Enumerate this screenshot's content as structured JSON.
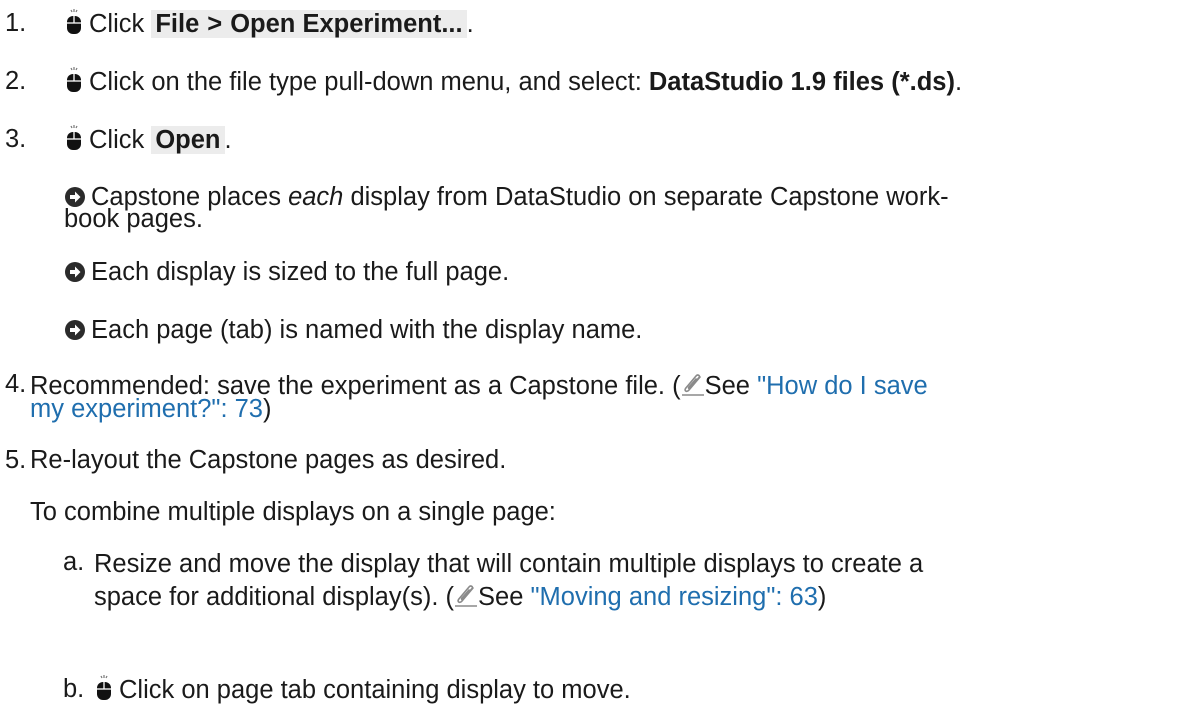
{
  "steps": {
    "s1": {
      "num": "1.",
      "click": "Click",
      "menu_file": "File",
      "gt": ">",
      "menu_open": "Open Experiment...",
      "period": "."
    },
    "s2": {
      "num": "2.",
      "text": "Click on the file type pull-down menu, and select:",
      "bold": "DataStudio 1.9 files (*.ds)",
      "period": "."
    },
    "s3": {
      "num": "3.",
      "click": "Click",
      "button": "Open",
      "period": ".",
      "results": [
        {
          "pre": "Capstone places",
          "emph": "each",
          "post": "display from DataStudio on separate Capstone work-",
          "cont": "book pages."
        },
        {
          "text": "Each display is sized to the full page."
        },
        {
          "text": "Each page (tab) is named with the display name."
        }
      ]
    },
    "s4": {
      "num": "4.",
      "text": "Recommended: save the experiment as a Capstone file. (",
      "see": "See",
      "link1": "\"How do I save",
      "link2": "my experiment?\":  73",
      "close": ")"
    },
    "s5": {
      "num": "5.",
      "text": "Re-layout the Capstone pages as desired.",
      "sub": "To combine multiple displays on a single page:",
      "a": {
        "label": "a.",
        "line1": "Resize and move the display that will contain multiple displays to create a",
        "line2": "space for additional display(s). (",
        "see": "See",
        "link": "\"Moving and resizing\":  63",
        "close": ")"
      },
      "b": {
        "label": "b.",
        "text": "Click on page tab containing display to move."
      }
    }
  }
}
